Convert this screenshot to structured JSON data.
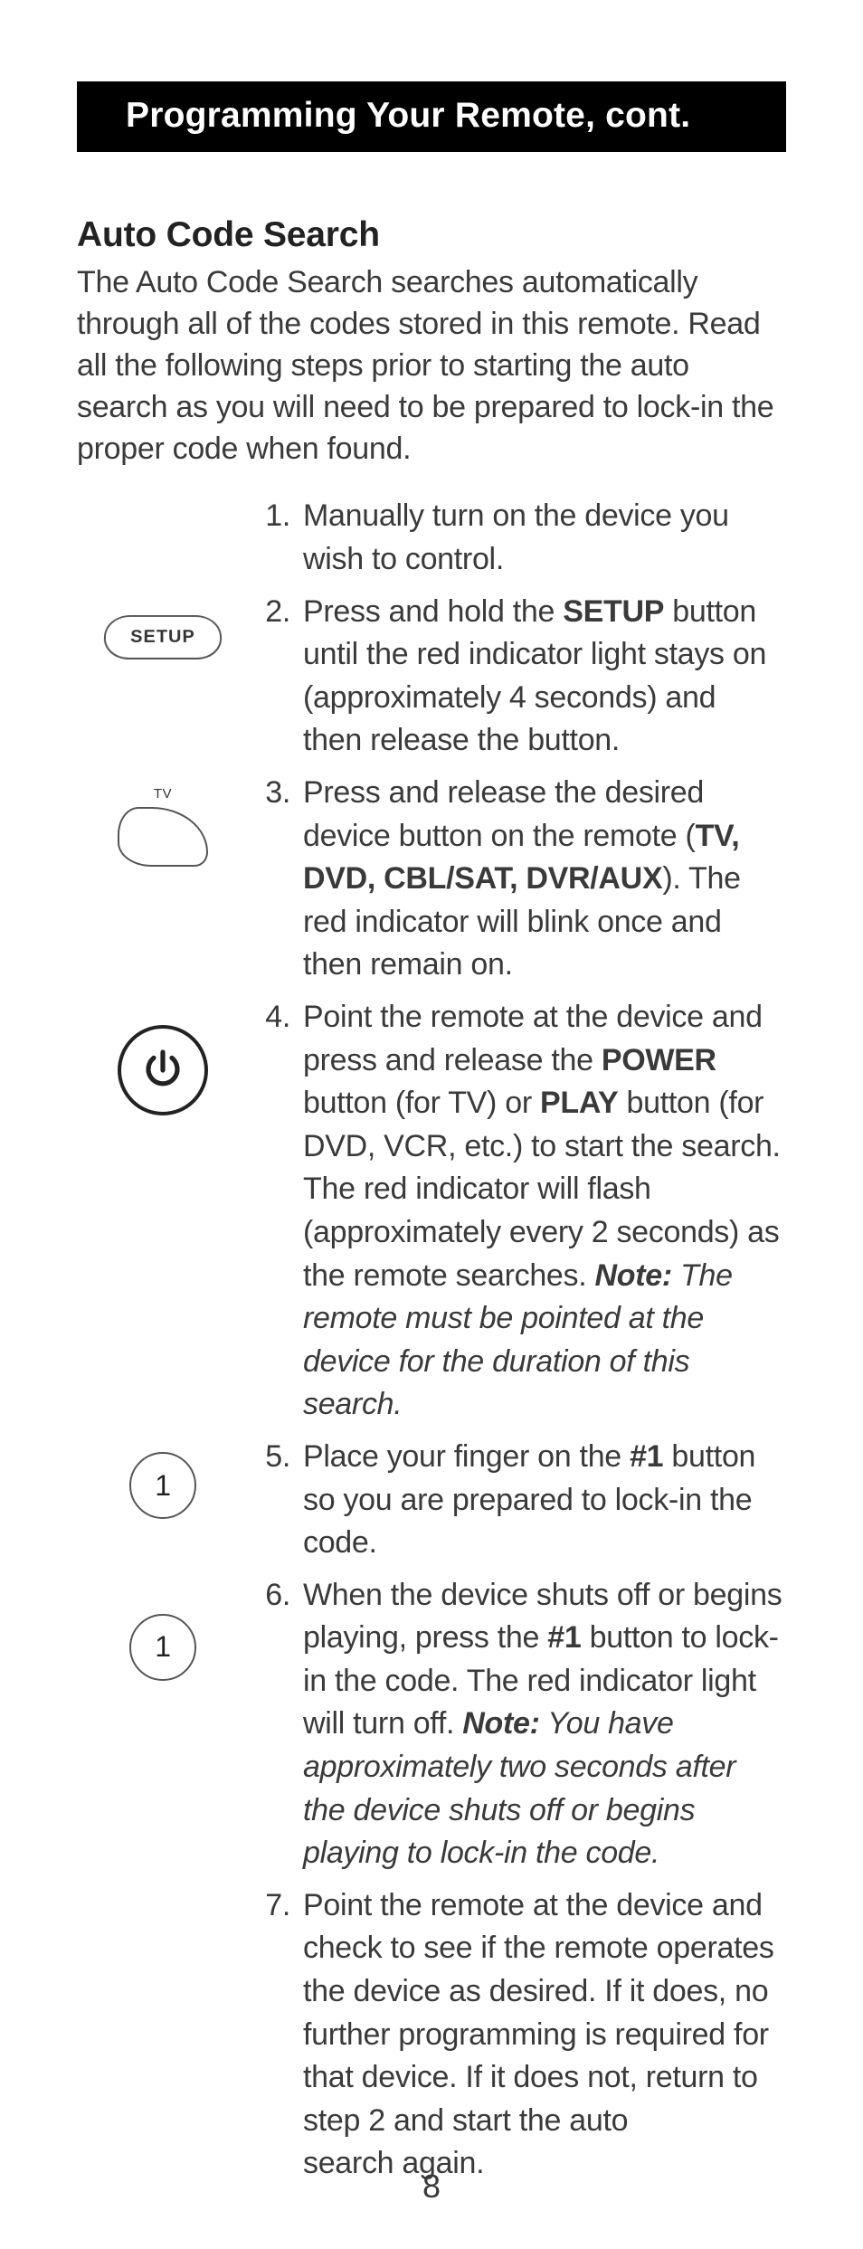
{
  "header": {
    "title": "Programming Your Remote, cont."
  },
  "section": {
    "title": "Auto Code Search",
    "intro": "The Auto Code Search searches automatically through all of the codes stored in this remote. Read all the following steps prior to starting the auto search as you will need to be prepared to lock-in the proper code when found."
  },
  "icons": {
    "setup_label": "SETUP",
    "tv_label": "TV",
    "one_label": "1"
  },
  "steps": {
    "s1": {
      "num": "1.",
      "t1": "Manually turn on the device you wish to control."
    },
    "s2": {
      "num": "2.",
      "t1": "Press and hold the ",
      "b1": "SETUP",
      "t2": " button until the red indicator light stays on (approximately 4 seconds) and then release the button."
    },
    "s3": {
      "num": "3.",
      "t1": "Press and release the desired device button on the remote (",
      "b1": "TV, DVD, CBL/SAT, DVR/AUX",
      "t2": "). The red indicator will blink once and then remain on."
    },
    "s4": {
      "num": "4.",
      "t1": "Point the remote at the device and press and release the ",
      "b1": "POWER",
      "t2": " button (for TV) or ",
      "b2": "PLAY",
      "t3": " button (for DVD, VCR, etc.) to start the search. The red indicator will flash (approximately every 2 seconds) as the remote searches. ",
      "note_label": "Note:",
      "note_text": " The remote must be pointed at the device for the duration of this search."
    },
    "s5": {
      "num": "5.",
      "t1": "Place your finger on the ",
      "b1": "#1",
      "t2": " button so you are prepared to lock-in the code."
    },
    "s6": {
      "num": "6.",
      "t1": "When the device shuts off or begins playing, press the ",
      "b1": "#1",
      "t2": " button to lock-in the code.  The red indicator light will turn off. ",
      "note_label": "Note:",
      "note_text": "  You have approximately two seconds after the device shuts off or begins playing to lock-in the code."
    },
    "s7": {
      "num": "7.",
      "t1": "Point the remote at the device and check to see if the remote operates the device as desired. If it does, no further programming is required for that device. If it does not, return to step 2 and start the auto search again."
    }
  },
  "page_number": "8"
}
